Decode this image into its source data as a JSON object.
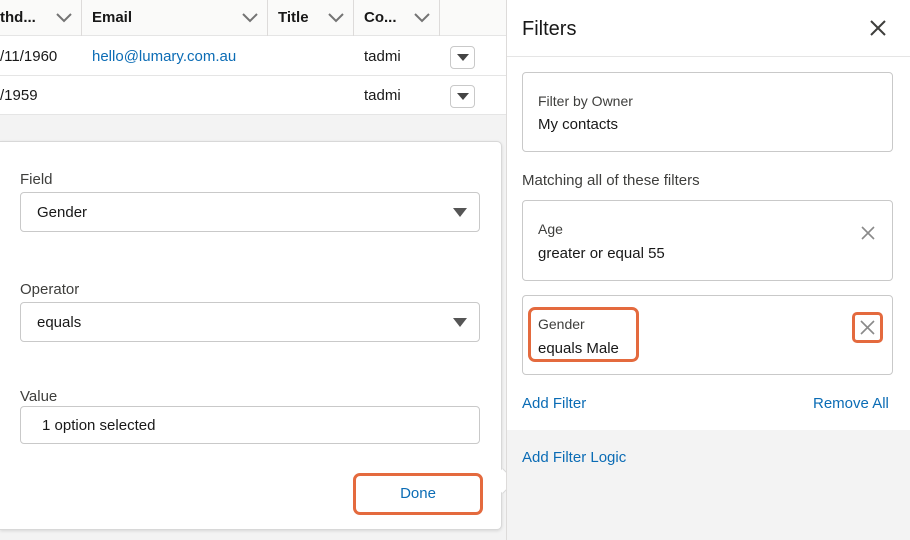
{
  "table": {
    "columns": [
      {
        "label": "thd..."
      },
      {
        "label": "Email"
      },
      {
        "label": "Title"
      },
      {
        "label": "Co..."
      }
    ],
    "rows": [
      {
        "birthdate": "/11/1960",
        "email": "hello@lumary.com.au",
        "owner": "tadmi"
      },
      {
        "birthdate": "/1959",
        "email": "",
        "owner": "tadmi"
      }
    ]
  },
  "editor": {
    "field_label": "Field",
    "field_value": "Gender",
    "operator_label": "Operator",
    "operator_value": "equals",
    "value_label": "Value",
    "value_value": "1 option selected",
    "done_label": "Done"
  },
  "panel": {
    "title": "Filters",
    "owner_label": "Filter by Owner",
    "owner_value": "My contacts",
    "matching_label": "Matching all of these filters",
    "filters": [
      {
        "label": "Age",
        "value": "greater or equal  55"
      },
      {
        "label": "Gender",
        "value": "equals  Male"
      }
    ],
    "add_filter": "Add Filter",
    "remove_all": "Remove All",
    "add_filter_logic": "Add Filter Logic"
  },
  "colors": {
    "link": "#0b6cb5",
    "highlight": "#e46a3e"
  }
}
